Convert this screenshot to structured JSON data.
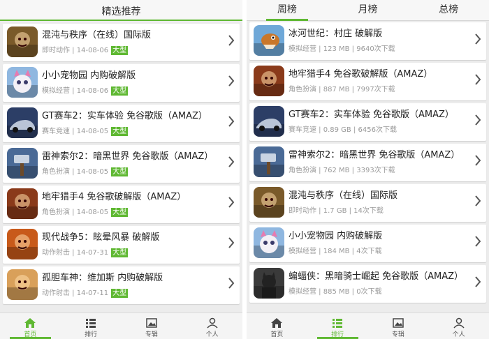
{
  "left": {
    "title": "精选推荐",
    "items": [
      {
        "name": "混沌与秩序（在线）国际版",
        "category": "即时动作",
        "date": "14-08-06",
        "badge": "大型",
        "icon": "orc-warrior-icon",
        "color": "#7a5a2a"
      },
      {
        "name": "小小宠物园 内购破解版",
        "category": "模拟经营",
        "date": "14-08-06",
        "badge": "大型",
        "icon": "pet-cat-icon",
        "color": "#8fb7e0"
      },
      {
        "name": "GT赛车2：实车体验 免谷歌版（AMAZ）",
        "category": "赛车竞速",
        "date": "14-08-05",
        "badge": "大型",
        "icon": "race-car-icon",
        "color": "#2c3e66"
      },
      {
        "name": "雷神索尔2：暗黑世界 免谷歌版（AMAZ）",
        "category": "角色扮演",
        "date": "14-08-05",
        "badge": "大型",
        "icon": "hammer-icon",
        "color": "#4a6a96"
      },
      {
        "name": "地牢猎手4 免谷歌破解版（AMAZ）",
        "category": "角色扮演",
        "date": "14-08-05",
        "badge": "大型",
        "icon": "dungeon-hunter-icon",
        "color": "#8a3a1a"
      },
      {
        "name": "现代战争5：眩晕风暴 破解版",
        "category": "动作射击",
        "date": "14-07-31",
        "badge": "大型",
        "icon": "soldier-icon",
        "color": "#c85a1a"
      },
      {
        "name": "孤胆车神：维加斯 内购破解版",
        "category": "动作射击",
        "date": "14-07-11",
        "badge": "大型",
        "icon": "vegas-man-icon",
        "color": "#d9a05a"
      }
    ],
    "nav": [
      {
        "label": "首页",
        "icon": "home-icon",
        "active": true
      },
      {
        "label": "排行",
        "icon": "list-icon",
        "active": false
      },
      {
        "label": "专辑",
        "icon": "album-icon",
        "active": false
      },
      {
        "label": "个人",
        "icon": "person-icon",
        "active": false
      }
    ]
  },
  "right": {
    "tabs": [
      {
        "label": "周榜",
        "active": true
      },
      {
        "label": "月榜",
        "active": false
      },
      {
        "label": "总榜",
        "active": false
      }
    ],
    "items": [
      {
        "name": "冰河世纪：村庄 破解版",
        "category": "模拟经营",
        "size": "123 MB",
        "downloads": "9640次下载",
        "icon": "dinosaur-icon",
        "color": "#6fa8d8"
      },
      {
        "name": "地牢猎手4 免谷歌破解版（AMAZ）",
        "category": "角色扮演",
        "size": "887 MB",
        "downloads": "7997次下载",
        "icon": "dungeon-hunter-icon",
        "color": "#8a3a1a"
      },
      {
        "name": "GT赛车2：实车体验 免谷歌版（AMAZ）",
        "category": "赛车竞速",
        "size": "0.89 GB",
        "downloads": "6456次下载",
        "icon": "race-car-icon",
        "color": "#2c3e66"
      },
      {
        "name": "雷神索尔2：暗黑世界 免谷歌版（AMAZ）",
        "category": "角色扮演",
        "size": "762 MB",
        "downloads": "3393次下载",
        "icon": "hammer-icon",
        "color": "#4a6a96"
      },
      {
        "name": "混沌与秩序（在线）国际版",
        "category": "即时动作",
        "size": "1.7 GB",
        "downloads": "14次下载",
        "icon": "orc-warrior-icon",
        "color": "#7a5a2a"
      },
      {
        "name": "小小宠物园 内购破解版",
        "category": "模拟经营",
        "size": "184 MB",
        "downloads": "4次下载",
        "icon": "pet-cat-icon",
        "color": "#8fb7e0"
      },
      {
        "name": "蝙蝠侠：黑暗骑士崛起 免谷歌版（AMAZ）",
        "category": "模拟经营",
        "size": "885 MB",
        "downloads": "0次下载",
        "icon": "batman-icon",
        "color": "#3a3a3a"
      }
    ],
    "nav": [
      {
        "label": "首页",
        "icon": "home-icon",
        "active": false
      },
      {
        "label": "排行",
        "icon": "list-icon",
        "active": true
      },
      {
        "label": "专辑",
        "icon": "album-icon",
        "active": false
      },
      {
        "label": "个人",
        "icon": "person-icon",
        "active": false
      }
    ]
  },
  "colors": {
    "accent": "#5fb832",
    "background": "#ececec",
    "card": "#ffffff"
  }
}
